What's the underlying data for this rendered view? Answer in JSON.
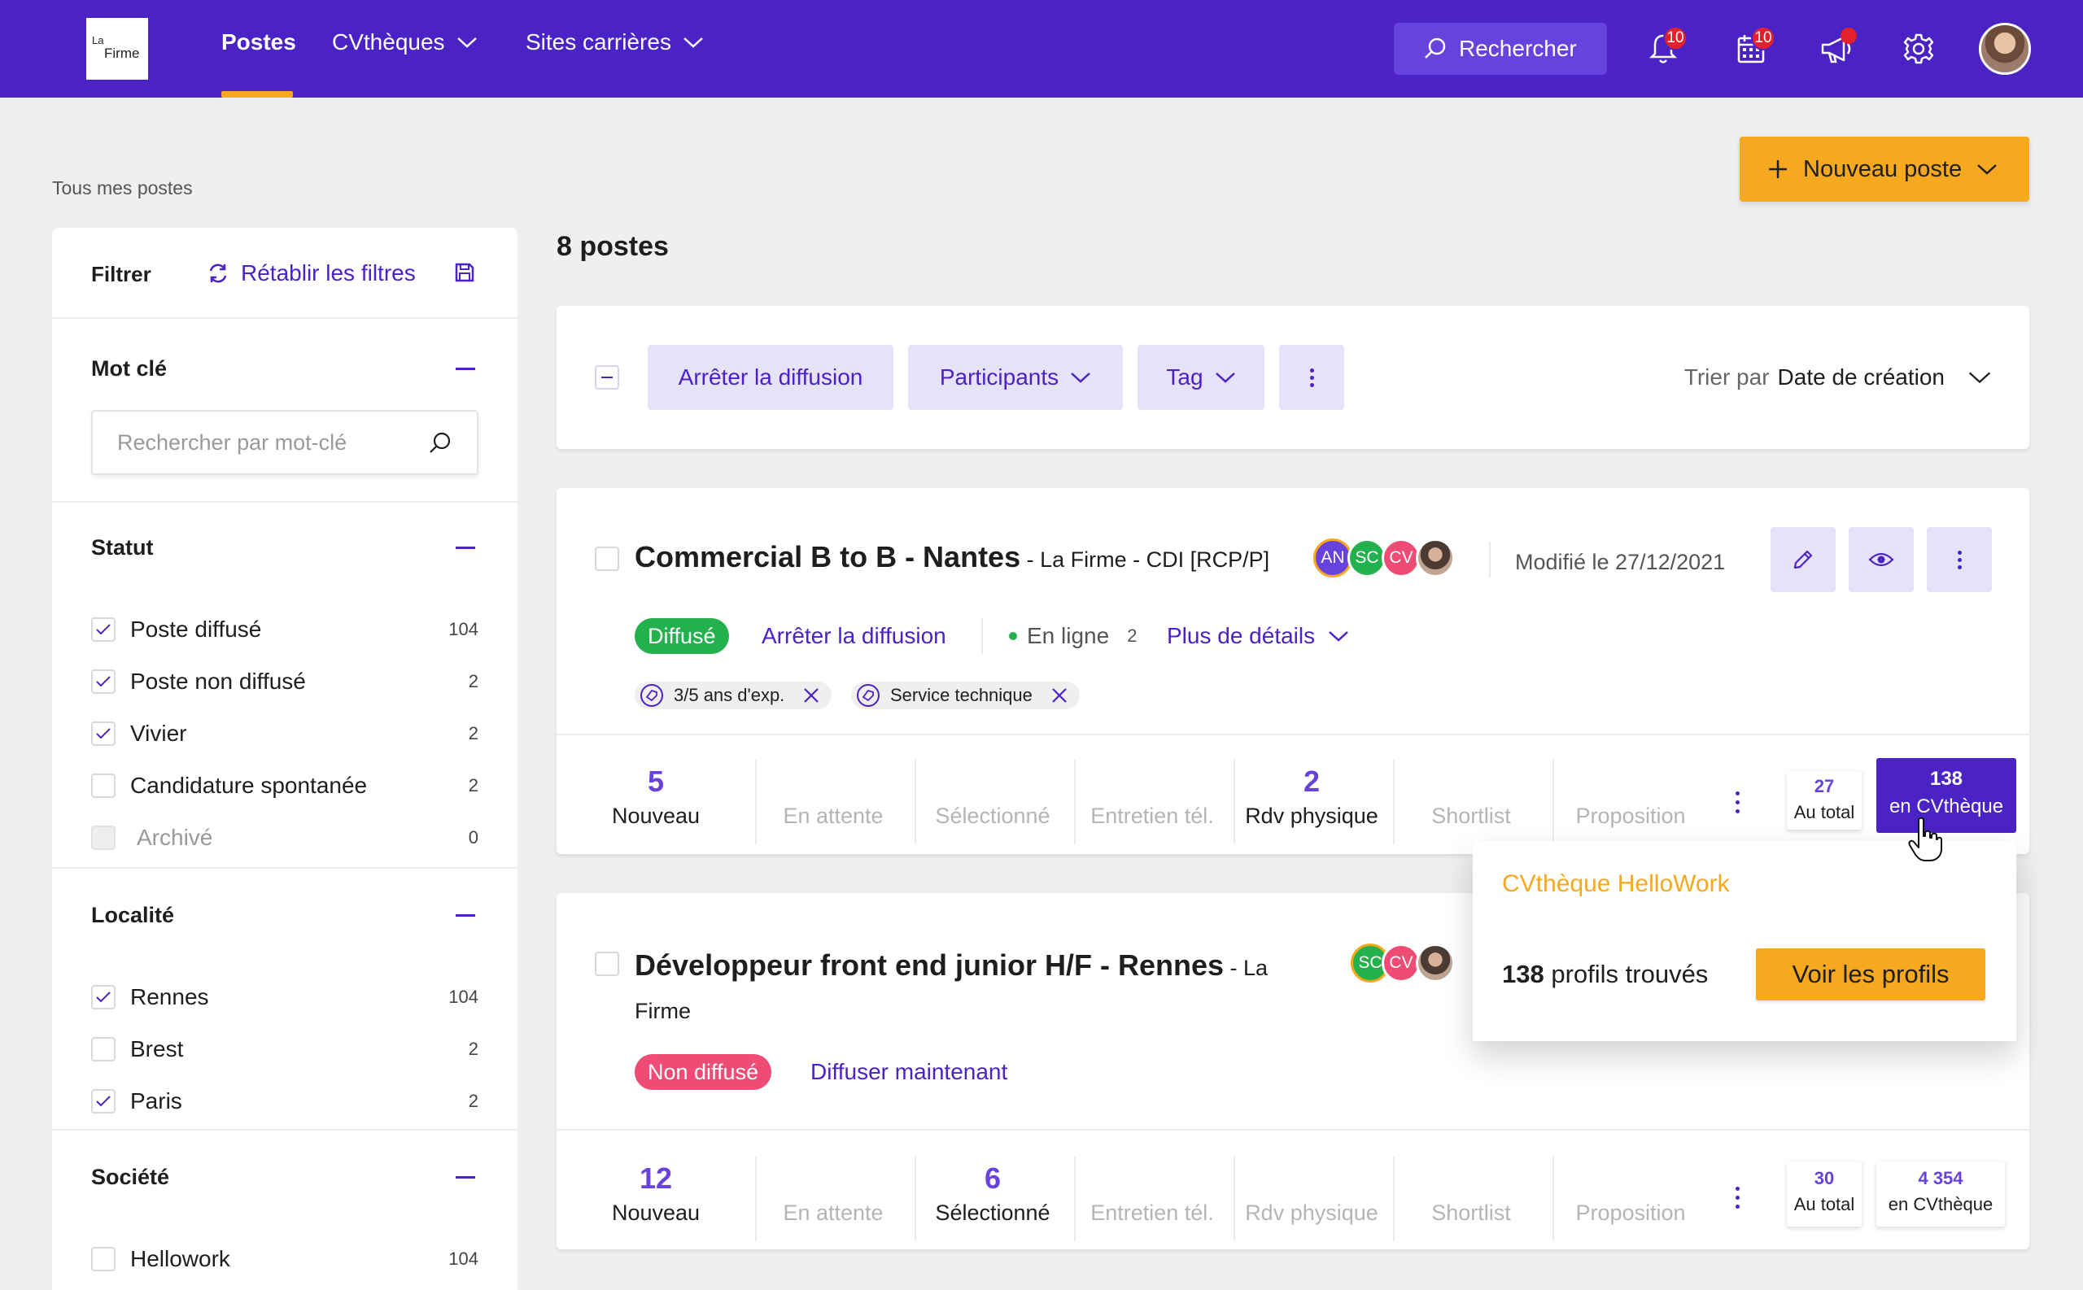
{
  "nav": {
    "logo_line1": "La",
    "logo_line2": "Firme",
    "links": [
      {
        "label": "Postes"
      },
      {
        "label": "CVthèques"
      },
      {
        "label": "Sites carrières"
      }
    ],
    "search_label": "Rechercher",
    "notifications_count": "10",
    "calendar_count": "10"
  },
  "breadcrumb": "Tous mes postes",
  "new_post_label": "Nouveau poste",
  "filters": {
    "title": "Filtrer",
    "reset_label": "Rétablir les filtres",
    "keyword": {
      "title": "Mot clé",
      "placeholder": "Rechercher par mot-clé"
    },
    "statut": {
      "title": "Statut",
      "items": [
        {
          "label": "Poste diffusé",
          "count": "104",
          "checked": true
        },
        {
          "label": "Poste non diffusé",
          "count": "2",
          "checked": true
        },
        {
          "label": "Vivier",
          "count": "2",
          "checked": true
        },
        {
          "label": "Candidature spontanée",
          "count": "2",
          "checked": false
        },
        {
          "label": "Archivé",
          "count": "0",
          "checked": false,
          "disabled": true
        }
      ]
    },
    "localite": {
      "title": "Localité",
      "items": [
        {
          "label": "Rennes",
          "count": "104",
          "checked": true
        },
        {
          "label": "Brest",
          "count": "2",
          "checked": false
        },
        {
          "label": "Paris",
          "count": "2",
          "checked": true
        }
      ]
    },
    "societe": {
      "title": "Société",
      "items": [
        {
          "label": "Hellowork",
          "count": "104",
          "checked": false
        }
      ]
    }
  },
  "main": {
    "count_title": "8 postes",
    "toolbar": {
      "stop_label": "Arrêter la diffusion",
      "participants_label": "Participants",
      "tag_label": "Tag",
      "sort_prefix": "Trier par",
      "sort_value": "Date de création"
    }
  },
  "jobs": [
    {
      "title": "Commercial B to B - Nantes",
      "subtitle": " - La Firme - CDI [RCP/P]",
      "avatars": [
        {
          "initials": "AN",
          "color": "#6742dc"
        },
        {
          "initials": "SC",
          "color": "#22b14c"
        },
        {
          "initials": "CV",
          "color": "#ee4c74"
        }
      ],
      "modified": "Modifié le 27/12/2021",
      "status": "Diffusé",
      "status_color": "#22b14c",
      "action_link": "Arrêter la diffusion",
      "online_label": "En ligne",
      "online_count": "2",
      "details_label": "Plus de détails",
      "tags": [
        "3/5 ans d'exp.",
        "Service technique"
      ],
      "stats": [
        {
          "num": "5",
          "label": "Nouveau"
        },
        {
          "num": "",
          "label": "En attente"
        },
        {
          "num": "",
          "label": "Sélectionné"
        },
        {
          "num": "",
          "label": "Entretien tél."
        },
        {
          "num": "2",
          "label": "Rdv physique"
        },
        {
          "num": "",
          "label": "Shortlist"
        },
        {
          "num": "",
          "label": "Proposition"
        }
      ],
      "total_num": "27",
      "total_label": "Au total",
      "cv_num": "138",
      "cv_label": "en CVthèque"
    },
    {
      "title": "Développeur front end junior H/F - Rennes",
      "subtitle_a": " - La",
      "subtitle_b": "Firme",
      "avatars": [
        {
          "initials": "SC",
          "color": "#22b14c"
        },
        {
          "initials": "CV",
          "color": "#ee4c74"
        }
      ],
      "status": "Non diffusé",
      "status_color": "#ee4c74",
      "action_link": "Diffuser maintenant",
      "stats": [
        {
          "num": "12",
          "label": "Nouveau"
        },
        {
          "num": "",
          "label": "En attente"
        },
        {
          "num": "6",
          "label": "Sélectionné"
        },
        {
          "num": "",
          "label": "Entretien tél."
        },
        {
          "num": "",
          "label": "Rdv physique"
        },
        {
          "num": "",
          "label": "Shortlist"
        },
        {
          "num": "",
          "label": "Proposition"
        }
      ],
      "total_num": "30",
      "total_label": "Au total",
      "cv_num": "4 354",
      "cv_label": "en CVthèque"
    }
  ],
  "popover": {
    "title": "CVthèque HelloWork",
    "count": "138",
    "count_suffix": " profils trouvés",
    "button_label": "Voir les profils"
  },
  "colors": {
    "brand": "#4b22c4",
    "accent": "#f6a91e",
    "success": "#22b14c",
    "danger": "#ee4c74"
  }
}
